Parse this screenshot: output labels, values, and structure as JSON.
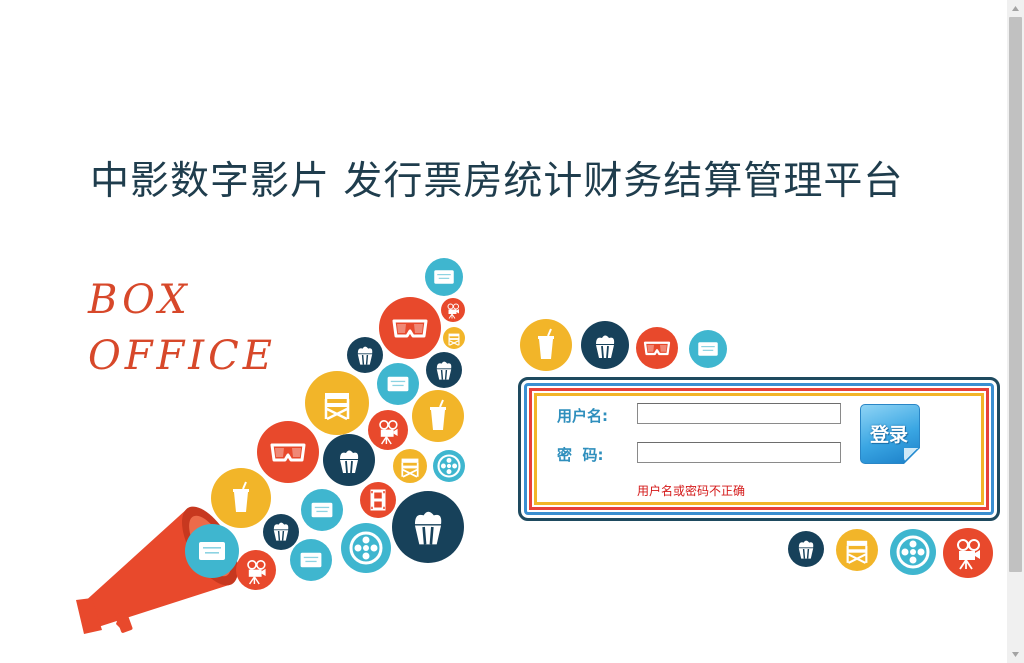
{
  "header": {
    "title": "中影数字影片 发行票房统计财务结算管理平台"
  },
  "banner": {
    "line1": "BOX",
    "line2": "OFFICE"
  },
  "login": {
    "username_label": "用户名:",
    "password_label": "密  码:",
    "username_value": "",
    "password_value": "",
    "submit_label": "登录",
    "error_text": "用户名或密码不正确"
  },
  "icons": [
    "megaphone-icon",
    "soda-cup-icon",
    "popcorn-icon",
    "3d-glasses-icon",
    "ticket-icon",
    "director-chair-icon",
    "movie-camera-icon",
    "film-reel-icon",
    "film-strip-icon"
  ],
  "colors": {
    "title": "#1f3d4d",
    "box_office": "#d7482a",
    "label": "#2f8fbd",
    "error": "#d41818",
    "orange": "#e8492c",
    "yellow": "#f2b529",
    "teal": "#3fb6cf",
    "navy": "#17415a"
  }
}
